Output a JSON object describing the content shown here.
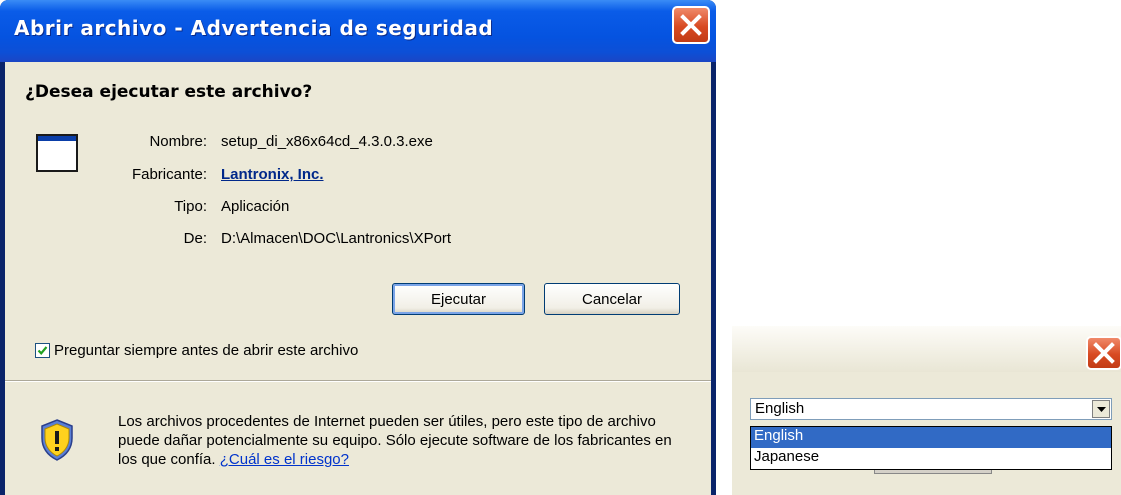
{
  "security_dialog": {
    "title": "Abrir archivo - Advertencia de seguridad",
    "question": "¿Desea ejecutar este archivo?",
    "fields": [
      {
        "label": "Nombre:",
        "value": "setup_di_x86x64cd_4.3.0.3.exe"
      },
      {
        "label": "Fabricante:",
        "value": "Lantronix, Inc."
      },
      {
        "label": "Tipo:",
        "value": "Aplicación"
      },
      {
        "label": "De:",
        "value": "D:\\Almacen\\DOC\\Lantronics\\XPort"
      }
    ],
    "run_button": "Ejecutar",
    "cancel_button": "Cancelar",
    "checkbox_label": "Preguntar siempre antes de abrir este archivo",
    "checkbox_checked": true,
    "warning_text": "Los archivos procedentes de Internet pueden ser útiles, pero este tipo de archivo puede dañar potencialmente su equipo. Sólo ejecute software de los fabricantes en los que confía.",
    "risk_link": "¿Cuál es el riesgo?"
  },
  "language_dialog": {
    "selected": "English",
    "options": [
      "English",
      "Japanese"
    ]
  }
}
